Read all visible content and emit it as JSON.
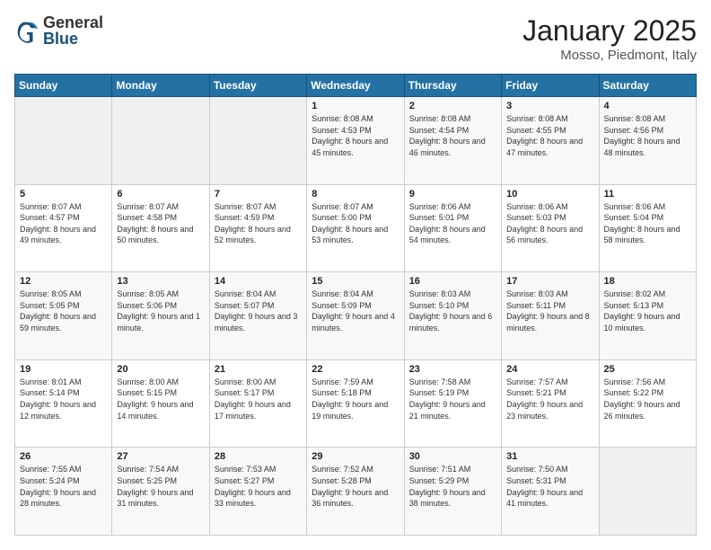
{
  "header": {
    "logo_general": "General",
    "logo_blue": "Blue",
    "month_title": "January 2025",
    "location": "Mosso, Piedmont, Italy"
  },
  "weekdays": [
    "Sunday",
    "Monday",
    "Tuesday",
    "Wednesday",
    "Thursday",
    "Friday",
    "Saturday"
  ],
  "weeks": [
    [
      {
        "day": "",
        "sunrise": "",
        "sunset": "",
        "daylight": "",
        "empty": true
      },
      {
        "day": "",
        "sunrise": "",
        "sunset": "",
        "daylight": "",
        "empty": true
      },
      {
        "day": "",
        "sunrise": "",
        "sunset": "",
        "daylight": "",
        "empty": true
      },
      {
        "day": "1",
        "sunrise": "Sunrise: 8:08 AM",
        "sunset": "Sunset: 4:53 PM",
        "daylight": "Daylight: 8 hours and 45 minutes."
      },
      {
        "day": "2",
        "sunrise": "Sunrise: 8:08 AM",
        "sunset": "Sunset: 4:54 PM",
        "daylight": "Daylight: 8 hours and 46 minutes."
      },
      {
        "day": "3",
        "sunrise": "Sunrise: 8:08 AM",
        "sunset": "Sunset: 4:55 PM",
        "daylight": "Daylight: 8 hours and 47 minutes."
      },
      {
        "day": "4",
        "sunrise": "Sunrise: 8:08 AM",
        "sunset": "Sunset: 4:56 PM",
        "daylight": "Daylight: 8 hours and 48 minutes."
      }
    ],
    [
      {
        "day": "5",
        "sunrise": "Sunrise: 8:07 AM",
        "sunset": "Sunset: 4:57 PM",
        "daylight": "Daylight: 8 hours and 49 minutes."
      },
      {
        "day": "6",
        "sunrise": "Sunrise: 8:07 AM",
        "sunset": "Sunset: 4:58 PM",
        "daylight": "Daylight: 8 hours and 50 minutes."
      },
      {
        "day": "7",
        "sunrise": "Sunrise: 8:07 AM",
        "sunset": "Sunset: 4:59 PM",
        "daylight": "Daylight: 8 hours and 52 minutes."
      },
      {
        "day": "8",
        "sunrise": "Sunrise: 8:07 AM",
        "sunset": "Sunset: 5:00 PM",
        "daylight": "Daylight: 8 hours and 53 minutes."
      },
      {
        "day": "9",
        "sunrise": "Sunrise: 8:06 AM",
        "sunset": "Sunset: 5:01 PM",
        "daylight": "Daylight: 8 hours and 54 minutes."
      },
      {
        "day": "10",
        "sunrise": "Sunrise: 8:06 AM",
        "sunset": "Sunset: 5:03 PM",
        "daylight": "Daylight: 8 hours and 56 minutes."
      },
      {
        "day": "11",
        "sunrise": "Sunrise: 8:06 AM",
        "sunset": "Sunset: 5:04 PM",
        "daylight": "Daylight: 8 hours and 58 minutes."
      }
    ],
    [
      {
        "day": "12",
        "sunrise": "Sunrise: 8:05 AM",
        "sunset": "Sunset: 5:05 PM",
        "daylight": "Daylight: 8 hours and 59 minutes."
      },
      {
        "day": "13",
        "sunrise": "Sunrise: 8:05 AM",
        "sunset": "Sunset: 5:06 PM",
        "daylight": "Daylight: 9 hours and 1 minute."
      },
      {
        "day": "14",
        "sunrise": "Sunrise: 8:04 AM",
        "sunset": "Sunset: 5:07 PM",
        "daylight": "Daylight: 9 hours and 3 minutes."
      },
      {
        "day": "15",
        "sunrise": "Sunrise: 8:04 AM",
        "sunset": "Sunset: 5:09 PM",
        "daylight": "Daylight: 9 hours and 4 minutes."
      },
      {
        "day": "16",
        "sunrise": "Sunrise: 8:03 AM",
        "sunset": "Sunset: 5:10 PM",
        "daylight": "Daylight: 9 hours and 6 minutes."
      },
      {
        "day": "17",
        "sunrise": "Sunrise: 8:03 AM",
        "sunset": "Sunset: 5:11 PM",
        "daylight": "Daylight: 9 hours and 8 minutes."
      },
      {
        "day": "18",
        "sunrise": "Sunrise: 8:02 AM",
        "sunset": "Sunset: 5:13 PM",
        "daylight": "Daylight: 9 hours and 10 minutes."
      }
    ],
    [
      {
        "day": "19",
        "sunrise": "Sunrise: 8:01 AM",
        "sunset": "Sunset: 5:14 PM",
        "daylight": "Daylight: 9 hours and 12 minutes."
      },
      {
        "day": "20",
        "sunrise": "Sunrise: 8:00 AM",
        "sunset": "Sunset: 5:15 PM",
        "daylight": "Daylight: 9 hours and 14 minutes."
      },
      {
        "day": "21",
        "sunrise": "Sunrise: 8:00 AM",
        "sunset": "Sunset: 5:17 PM",
        "daylight": "Daylight: 9 hours and 17 minutes."
      },
      {
        "day": "22",
        "sunrise": "Sunrise: 7:59 AM",
        "sunset": "Sunset: 5:18 PM",
        "daylight": "Daylight: 9 hours and 19 minutes."
      },
      {
        "day": "23",
        "sunrise": "Sunrise: 7:58 AM",
        "sunset": "Sunset: 5:19 PM",
        "daylight": "Daylight: 9 hours and 21 minutes."
      },
      {
        "day": "24",
        "sunrise": "Sunrise: 7:57 AM",
        "sunset": "Sunset: 5:21 PM",
        "daylight": "Daylight: 9 hours and 23 minutes."
      },
      {
        "day": "25",
        "sunrise": "Sunrise: 7:56 AM",
        "sunset": "Sunset: 5:22 PM",
        "daylight": "Daylight: 9 hours and 26 minutes."
      }
    ],
    [
      {
        "day": "26",
        "sunrise": "Sunrise: 7:55 AM",
        "sunset": "Sunset: 5:24 PM",
        "daylight": "Daylight: 9 hours and 28 minutes."
      },
      {
        "day": "27",
        "sunrise": "Sunrise: 7:54 AM",
        "sunset": "Sunset: 5:25 PM",
        "daylight": "Daylight: 9 hours and 31 minutes."
      },
      {
        "day": "28",
        "sunrise": "Sunrise: 7:53 AM",
        "sunset": "Sunset: 5:27 PM",
        "daylight": "Daylight: 9 hours and 33 minutes."
      },
      {
        "day": "29",
        "sunrise": "Sunrise: 7:52 AM",
        "sunset": "Sunset: 5:28 PM",
        "daylight": "Daylight: 9 hours and 36 minutes."
      },
      {
        "day": "30",
        "sunrise": "Sunrise: 7:51 AM",
        "sunset": "Sunset: 5:29 PM",
        "daylight": "Daylight: 9 hours and 38 minutes."
      },
      {
        "day": "31",
        "sunrise": "Sunrise: 7:50 AM",
        "sunset": "Sunset: 5:31 PM",
        "daylight": "Daylight: 9 hours and 41 minutes."
      },
      {
        "day": "",
        "sunrise": "",
        "sunset": "",
        "daylight": "",
        "empty": true
      }
    ]
  ]
}
